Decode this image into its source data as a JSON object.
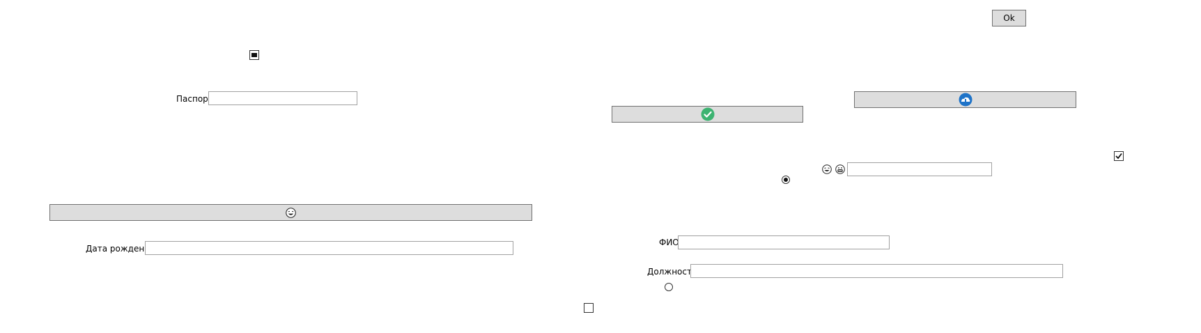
{
  "form": {
    "ok_button_label": "Ok",
    "passport_label": "Паспорт",
    "passport_value": "",
    "birthdate_label": "Дата рождения",
    "birthdate_value": "",
    "fio_label": "ФИО",
    "fio_value": "",
    "position_label": "Должность",
    "position_value": "",
    "emoji_field_value": ""
  },
  "checkboxes": {
    "top_left_state": "indeterminate",
    "right_state": "checked",
    "bottom_state": "unchecked"
  },
  "radios": {
    "upper_checked": true,
    "lower_checked": false
  },
  "icons": {
    "check_button_icon": "check-circle-icon",
    "blue_button_icon": "blue-cloud-icon",
    "wide_button_icon": "laughing-emoji-icon",
    "emoji_1": "laughing-emoji-icon",
    "emoji_2": "grinning-emoji-icon"
  },
  "colors": {
    "button_bg": "#dddddd",
    "check_green": "#3cb371",
    "icon_blue": "#1e73c8"
  }
}
